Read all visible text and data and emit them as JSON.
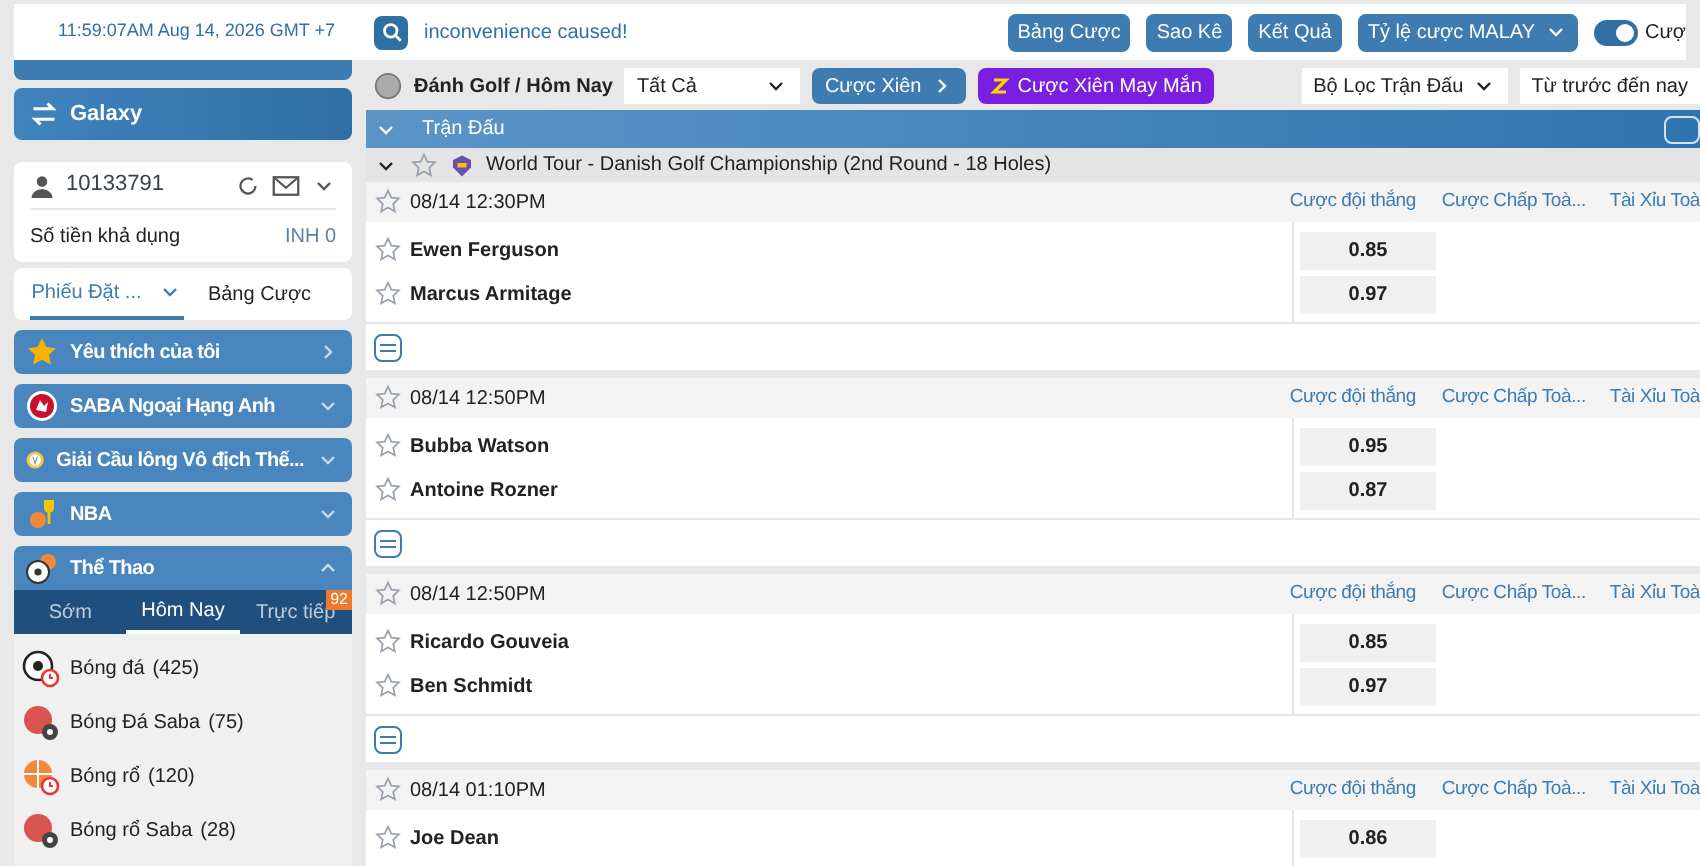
{
  "top_bar": {
    "clock": "11:59:07AM Aug 14, 2026 GMT +7",
    "ticker": "inconvenience caused!",
    "buttons": [
      "Bảng Cược",
      "Sao Kê",
      "Kết Quả"
    ],
    "odds_menu": "Tỷ lệ cược MALAY",
    "toggle": {
      "label": "Cượ",
      "on": true
    }
  },
  "sidebar": {
    "banner": "Galaxy",
    "account": {
      "user_id": "10133791",
      "balance_label": "Số tiền khả dụng",
      "balance": "INH 0"
    },
    "slip_tabs": [
      {
        "label": "Phiếu Đặt ...",
        "selected": true
      },
      {
        "label": "Bảng Cược",
        "selected": false
      }
    ],
    "menu": [
      {
        "label": "Yêu thích của tôi",
        "kind": "star",
        "expanded": false,
        "link": true
      },
      {
        "label": "SABA Ngoại Hạng Anh",
        "kind": "league",
        "expanded": false,
        "link": false
      },
      {
        "label": "Giải Cầu lông Vô địch Thế...",
        "kind": "badminton",
        "expanded": false,
        "link": false
      },
      {
        "label": "NBA",
        "kind": "trophy",
        "expanded": false,
        "link": false
      },
      {
        "label": "Thể Thao",
        "kind": "sports",
        "expanded": true,
        "link": false
      }
    ],
    "period_tabs": [
      {
        "label": "Sớm",
        "selected": false
      },
      {
        "label": "Hôm Nay",
        "selected": true
      },
      {
        "label": "Trực tiếp",
        "selected": false,
        "badge": "92"
      }
    ],
    "sports": [
      {
        "label": "Bóng đá",
        "count": "(425)",
        "kind": "soccer"
      },
      {
        "label": "Bóng Đá Saba",
        "count": "(75)",
        "kind": "saba"
      },
      {
        "label": "Bóng rổ",
        "count": "(120)",
        "kind": "basketball"
      },
      {
        "label": "Bóng rổ Saba",
        "count": "(28)",
        "kind": "saba"
      }
    ]
  },
  "toolbar": {
    "title": "Đánh Golf / Hôm Nay",
    "filter": "Tất Cả",
    "parlay": "Cược Xiên",
    "lucky": "Cược Xiên May Mắn",
    "match_filter": "Bộ Lọc Trận Đấu",
    "sort": "Từ trước đến nay"
  },
  "table": {
    "header": "Trận Đấu",
    "league": "World Tour - Danish Golf Championship (2nd Round - 18 Holes)",
    "matches": [
      {
        "time": "08/14 12:30PM",
        "columns": [
          "Cược đội thắng",
          "Cược Chấp Toà...",
          "Tài Xỉu Toà"
        ],
        "players": [
          {
            "name": "Ewen Ferguson",
            "odds": "0.85"
          },
          {
            "name": "Marcus Armitage",
            "odds": "0.97"
          }
        ]
      },
      {
        "time": "08/14 12:50PM",
        "columns": [
          "Cược đội thắng",
          "Cược Chấp Toà...",
          "Tài Xỉu Toà"
        ],
        "players": [
          {
            "name": "Bubba Watson",
            "odds": "0.95"
          },
          {
            "name": "Antoine Rozner",
            "odds": "0.87"
          }
        ]
      },
      {
        "time": "08/14 12:50PM",
        "columns": [
          "Cược đội thắng",
          "Cược Chấp Toà...",
          "Tài Xỉu Toà"
        ],
        "players": [
          {
            "name": "Ricardo Gouveia",
            "odds": "0.85"
          },
          {
            "name": "Ben Schmidt",
            "odds": "0.97"
          }
        ]
      },
      {
        "time": "08/14 01:10PM",
        "columns": [
          "Cược đội thắng",
          "Cược Chấp Toà...",
          "Tài Xỉu Toà"
        ],
        "players": [
          {
            "name": "Joe Dean",
            "odds": "0.86"
          }
        ]
      }
    ]
  }
}
